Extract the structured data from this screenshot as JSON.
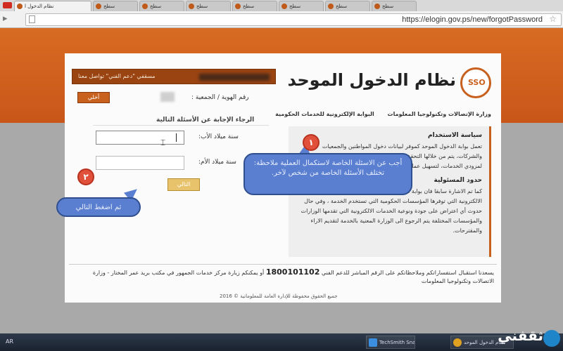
{
  "browser": {
    "tabs": [
      {
        "label": "نظام الدخول ا",
        "active": true
      },
      {
        "label": "سطح",
        "active": false
      },
      {
        "label": "سطح",
        "active": false
      },
      {
        "label": "سطح",
        "active": false
      },
      {
        "label": "سطح",
        "active": false
      },
      {
        "label": "سطح",
        "active": false
      },
      {
        "label": "سطح",
        "active": false
      },
      {
        "label": "سطح",
        "active": false
      }
    ],
    "url": "https://elogin.gov.ps/new/forgotPassword"
  },
  "header": {
    "logo_text": "SSO",
    "title": "نظام الدخول الموحد",
    "login_bar_text": "مسقفي \"دعم الفني\" تواصل معنا",
    "nav": [
      "وزارة الإتصالات وتكنولوجيا المعلومات",
      "البوابة الإلكترونية للخدمات الحكومية"
    ]
  },
  "form": {
    "id_label": "رقم الهوية / الجمعية :",
    "id_button": "أخلي",
    "questions_title": "الرجاء الإجابة عن الأسئلة التالية",
    "q1_label": "سنة ميلاد الأب:",
    "q2_label": "سنة ميلاد الأم:",
    "next_button": "التالي"
  },
  "side": {
    "policy_title": "سياسة الاستخدام",
    "policy_text": "تعمل بوابة الدخول الموحد كموفر لبيانات دخول المواطنين والجمعيات والشركات، يتم من خلالها التحقق من بيانات المستخدم، يتم توفير هذه الخدمة لمزودي الخدمات، لتسهيل عمليات التسجيل والدخول.",
    "liability_title": "حدود المسئولية",
    "liability_text": "كما تم الاشارة سابقا فان بوابة الدخول الموحد غير مسئولة عن الخدمات الالكترونية التي توفرها المؤسسات الحكومية التي تستخدم الخدمة ، وفي حال حدوث أي اعتراض على جودة ونوعية الخدمات الالكترونية التي تقدمها الوزارات والمؤسسات المختلفة يتم الرجوع الى الوزارة المعنية بالخدمة لتقديم الاراء والمقترحات."
  },
  "footer": {
    "text_a": "يسعدنا استقبال استفساراتكم وملاحظاتكم على الرقم المباشر للدعم الفني",
    "phone": "1800101102",
    "text_b": "أو يمكنكم زيارة مركز خدمات الجمهور في مكتب بريد عمر المختار - وزارة الاتصالات وتكنولوجيا المعلومات",
    "copyright": "جميع الحقوق محفوظة للإدارة العامة للمعلوماتية © 2016"
  },
  "callouts": {
    "c1_num": "١",
    "c1_text": "أجب عن الاسئلة الخاصة لاستكمال العملية ملاحظة: تختلف الأسئلة الخاصة من شخص لآخر.",
    "c2_num": "٢",
    "c2_text": "ثم اضغط التالي"
  },
  "taskbar": {
    "items": [
      "TechSmith Snagit",
      "نظام الدخول الموحد"
    ],
    "tray": "AR",
    "watermark": "ثقفني"
  }
}
